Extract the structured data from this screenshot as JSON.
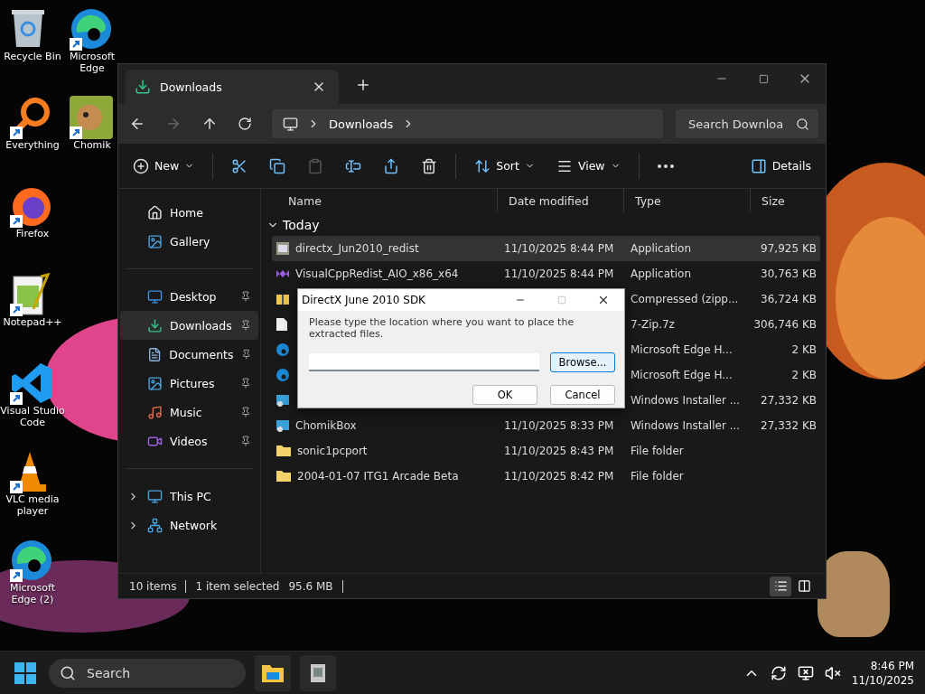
{
  "desktop": {
    "icon_columns": [
      {
        "icons": [
          {
            "label": "Recycle Bin",
            "kind": "recycle",
            "shortcut": false
          },
          {
            "label": "Everything",
            "kind": "everything",
            "shortcut": true
          },
          {
            "label": "Firefox",
            "kind": "firefox",
            "shortcut": true
          },
          {
            "label": "Notepad++",
            "kind": "notepad",
            "shortcut": true
          },
          {
            "label": "Visual Studio Code",
            "kind": "vscode",
            "shortcut": true
          },
          {
            "label": "VLC media player",
            "kind": "vlc",
            "shortcut": true
          },
          {
            "label": "Microsoft Edge (2)",
            "kind": "edge",
            "shortcut": true
          }
        ]
      },
      {
        "icons": [
          {
            "label": "Microsoft Edge",
            "kind": "edge",
            "shortcut": true
          },
          {
            "label": "Chomik",
            "kind": "chomik",
            "shortcut": true
          }
        ]
      }
    ]
  },
  "explorer": {
    "tab": {
      "title": "Downloads"
    },
    "breadcrumb": [
      "Downloads"
    ],
    "search": {
      "placeholder": "Search Downloa"
    },
    "toolbar": [
      {
        "kind": "new",
        "label": "New",
        "disabled": false
      },
      {
        "kind": "cut",
        "disabled": false
      },
      {
        "kind": "copy",
        "disabled": false
      },
      {
        "kind": "paste",
        "disabled": true
      },
      {
        "kind": "rename",
        "disabled": false
      },
      {
        "kind": "share",
        "disabled": false
      },
      {
        "kind": "delete",
        "disabled": false
      },
      {
        "kind": "sort",
        "label": "Sort",
        "disabled": false
      },
      {
        "kind": "view",
        "label": "View",
        "disabled": false
      },
      {
        "kind": "more",
        "disabled": false
      },
      {
        "kind": "details",
        "label": "Details",
        "disabled": false
      }
    ],
    "sidebar": {
      "groups": [
        {
          "items": [
            {
              "label": "Home",
              "kind": "home",
              "selected": false,
              "pinned": false,
              "expandable": false
            },
            {
              "label": "Gallery",
              "kind": "gallery",
              "selected": false,
              "pinned": false,
              "expandable": false
            }
          ]
        },
        {
          "items": [
            {
              "label": "Desktop",
              "kind": "desktop",
              "selected": false,
              "pinned": true,
              "expandable": false
            },
            {
              "label": "Downloads",
              "kind": "downloads",
              "selected": true,
              "pinned": true,
              "expandable": false
            },
            {
              "label": "Documents",
              "kind": "documents",
              "selected": false,
              "pinned": true,
              "expandable": false
            },
            {
              "label": "Pictures",
              "kind": "pictures",
              "selected": false,
              "pinned": true,
              "expandable": false
            },
            {
              "label": "Music",
              "kind": "music",
              "selected": false,
              "pinned": true,
              "expandable": false
            },
            {
              "label": "Videos",
              "kind": "videos",
              "selected": false,
              "pinned": true,
              "expandable": false
            }
          ]
        },
        {
          "items": [
            {
              "label": "This PC",
              "kind": "pc",
              "selected": false,
              "pinned": false,
              "expandable": true
            },
            {
              "label": "Network",
              "kind": "network",
              "selected": false,
              "pinned": false,
              "expandable": true
            }
          ]
        }
      ]
    },
    "files": {
      "columns": [
        "Name",
        "Date modified",
        "Type",
        "Size"
      ],
      "group": "Today",
      "rows": [
        {
          "kind": "app",
          "name": "directx_Jun2010_redist",
          "date": "11/10/2025 8:44 PM",
          "type": "Application",
          "size": "97,925 KB",
          "selected": true
        },
        {
          "kind": "vs",
          "name": "VisualCppRedist_AIO_x86_x64",
          "date": "11/10/2025 8:44 PM",
          "type": "Application",
          "size": "30,763 KB",
          "selected": false
        },
        {
          "kind": "zip",
          "type": "Compressed (zipp...",
          "size": "36,724 KB",
          "selected": false
        },
        {
          "kind": "file",
          "type": "7-Zip.7z",
          "size": "306,746 KB",
          "selected": false
        },
        {
          "kind": "edge",
          "type": "Microsoft Edge H...",
          "size": "2 KB",
          "selected": false
        },
        {
          "kind": "edge",
          "type": "Microsoft Edge H...",
          "size": "2 KB",
          "selected": false
        },
        {
          "kind": "installer",
          "type": "Windows Installer ...",
          "size": "27,332 KB",
          "selected": false
        },
        {
          "kind": "installer",
          "name": "ChomikBox",
          "date": "11/10/2025 8:33 PM",
          "type": "Windows Installer ...",
          "size": "27,332 KB",
          "selected": false
        },
        {
          "kind": "folder",
          "name": "sonic1pcport",
          "date": "11/10/2025 8:43 PM",
          "type": "File folder",
          "selected": false
        },
        {
          "kind": "folder",
          "name": "2004-01-07 ITG1 Arcade Beta",
          "date": "11/10/2025 8:42 PM",
          "type": "File folder",
          "selected": false
        }
      ]
    },
    "status_bar": {
      "items": "10 items",
      "selection": "1 item selected",
      "size": "95.6 MB"
    },
    "view_buttons": [
      {
        "kind": "details",
        "selected": true
      },
      {
        "kind": "tiles",
        "selected": false
      }
    ]
  },
  "dialog": {
    "title": "DirectX June 2010 SDK",
    "message": "Please type the location where you want to place the extracted files.",
    "browse": "Browse...",
    "ok": "OK",
    "cancel": "Cancel"
  },
  "taskbar": {
    "search": {
      "placeholder": "Search"
    },
    "apps": [
      {
        "kind": "explorer"
      },
      {
        "kind": "installer"
      }
    ],
    "time": "8:46 PM",
    "date": "11/10/2025"
  }
}
